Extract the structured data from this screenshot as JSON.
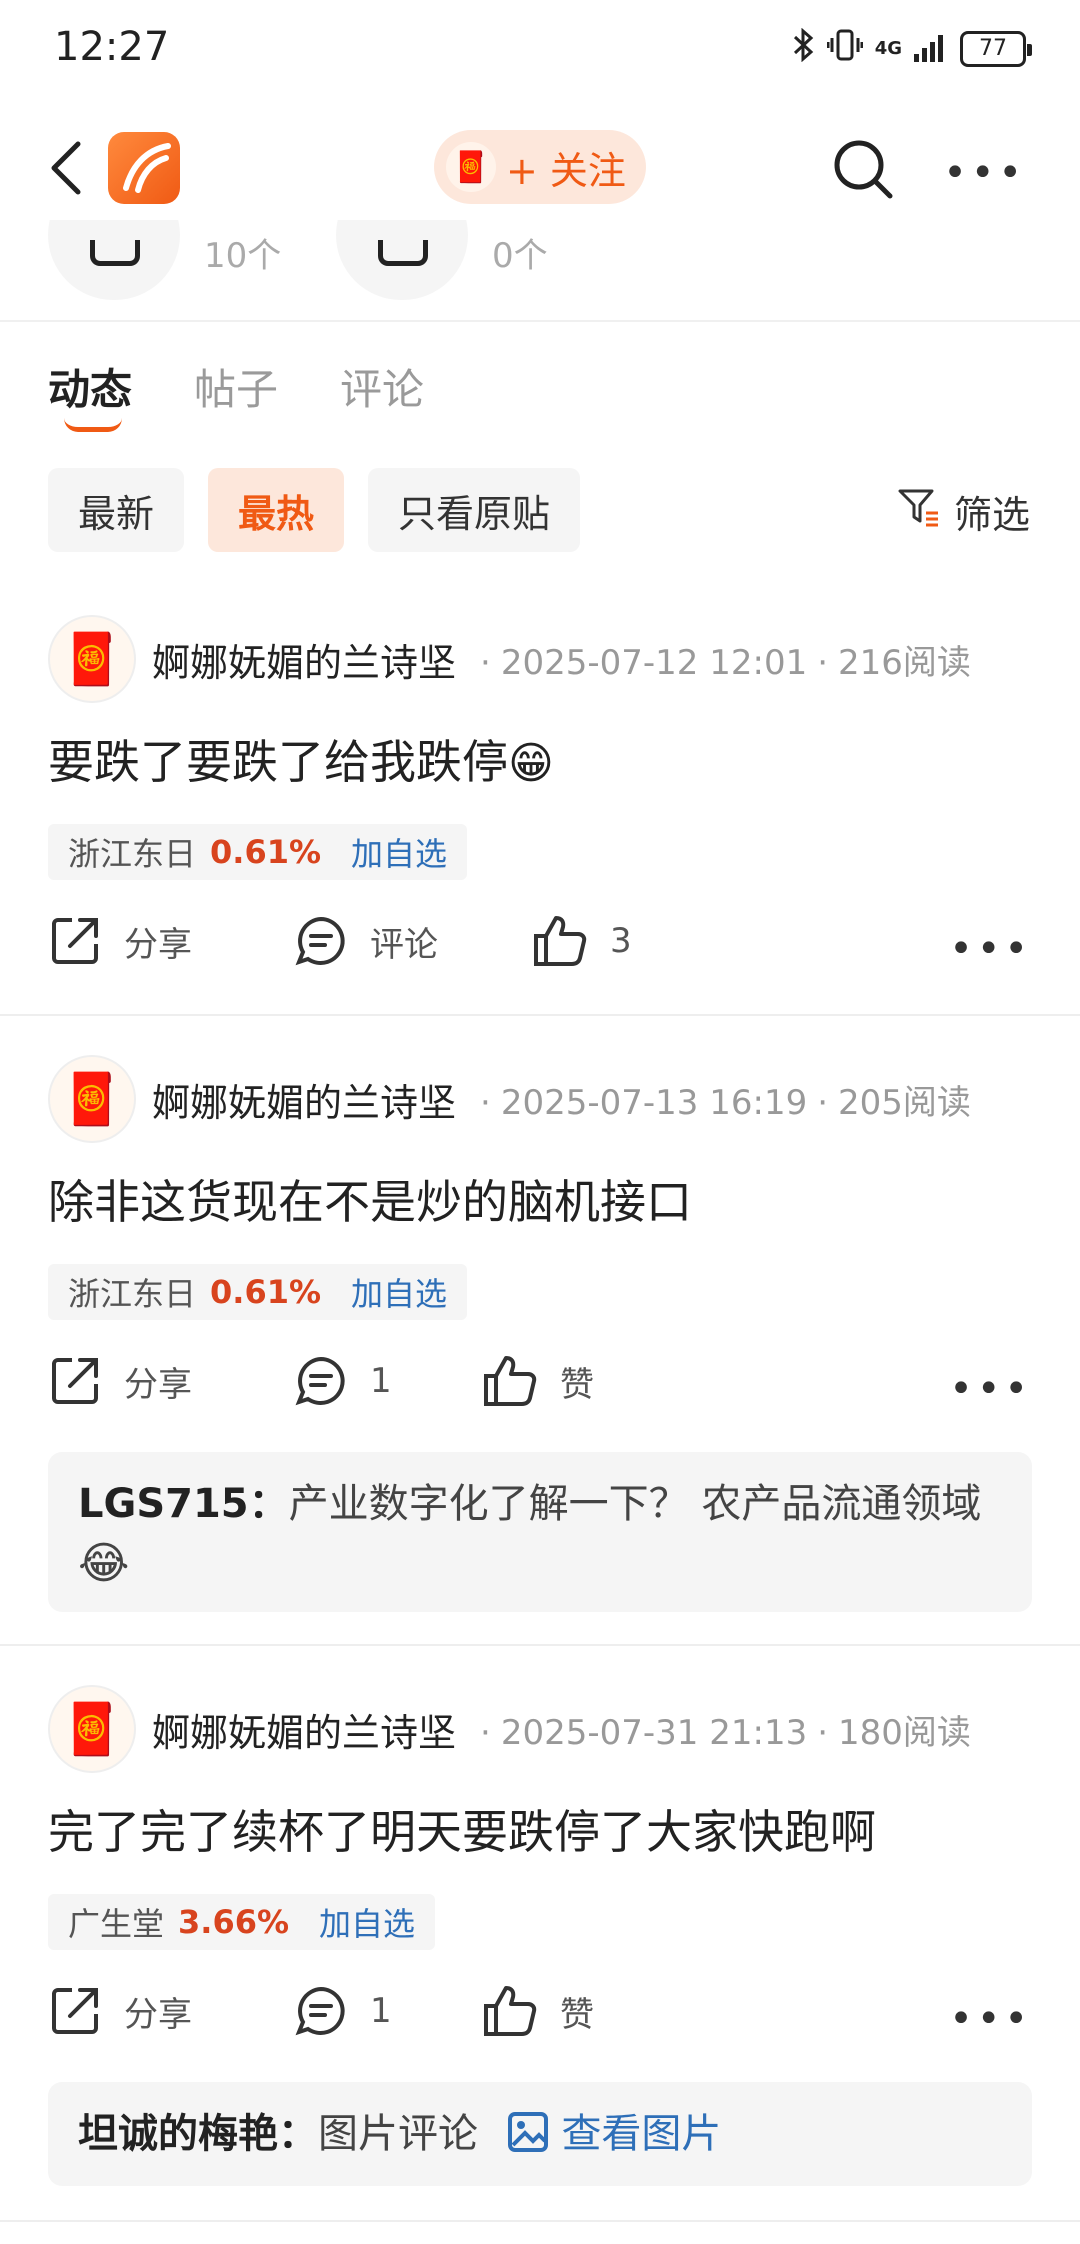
{
  "status_bar": {
    "time": "12:27",
    "battery": "77",
    "network": "4G"
  },
  "header": {
    "follow_label": "+ 关注",
    "follow_avatar_icon": "🧧"
  },
  "stats": [
    {
      "count": "10个"
    },
    {
      "count": "0个"
    }
  ],
  "tabs": [
    {
      "label": "动态"
    },
    {
      "label": "帖子"
    },
    {
      "label": "评论"
    }
  ],
  "filters": [
    {
      "label": "最新"
    },
    {
      "label": "最热"
    },
    {
      "label": "只看原贴"
    }
  ],
  "filter_button": "筛选",
  "posts": [
    {
      "user": "婀娜妩媚的兰诗坚",
      "date": "2025-07-12 12:01",
      "reads": "216阅读",
      "text": "要跌了要跌了给我跌停",
      "emoji": "😁",
      "stock_name": "浙江东日",
      "stock_pct": "0.61%",
      "stock_add": "加自选",
      "share": "分享",
      "comment": "评论",
      "like": "3"
    },
    {
      "user": "婀娜妩媚的兰诗坚",
      "date": "2025-07-13 16:19",
      "reads": "205阅读",
      "text": "除非这货现在不是炒的脑机接口",
      "stock_name": "浙江东日",
      "stock_pct": "0.61%",
      "stock_add": "加自选",
      "share": "分享",
      "comment": "1",
      "like": "赞",
      "reply_user": "LGS715：",
      "reply_text": "产业数字化了解一下？ 农产品流通领域",
      "reply_emoji": "😂"
    },
    {
      "user": "婀娜妩媚的兰诗坚",
      "date": "2025-07-31 21:13",
      "reads": "180阅读",
      "text": "完了完了续杯了明天要跌停了大家快跑啊",
      "stock_name": "广生堂",
      "stock_pct": "3.66%",
      "stock_add": "加自选",
      "share": "分享",
      "comment": "1",
      "like": "赞",
      "reply_user": "坦诚的梅艳：",
      "reply_text": "图片评论",
      "reply_link": "查看图片"
    }
  ],
  "colors": {
    "accent": "#f05a14",
    "accent_bg": "#fde7db",
    "link": "#2e6fb8",
    "stock_up": "#d8441e"
  }
}
